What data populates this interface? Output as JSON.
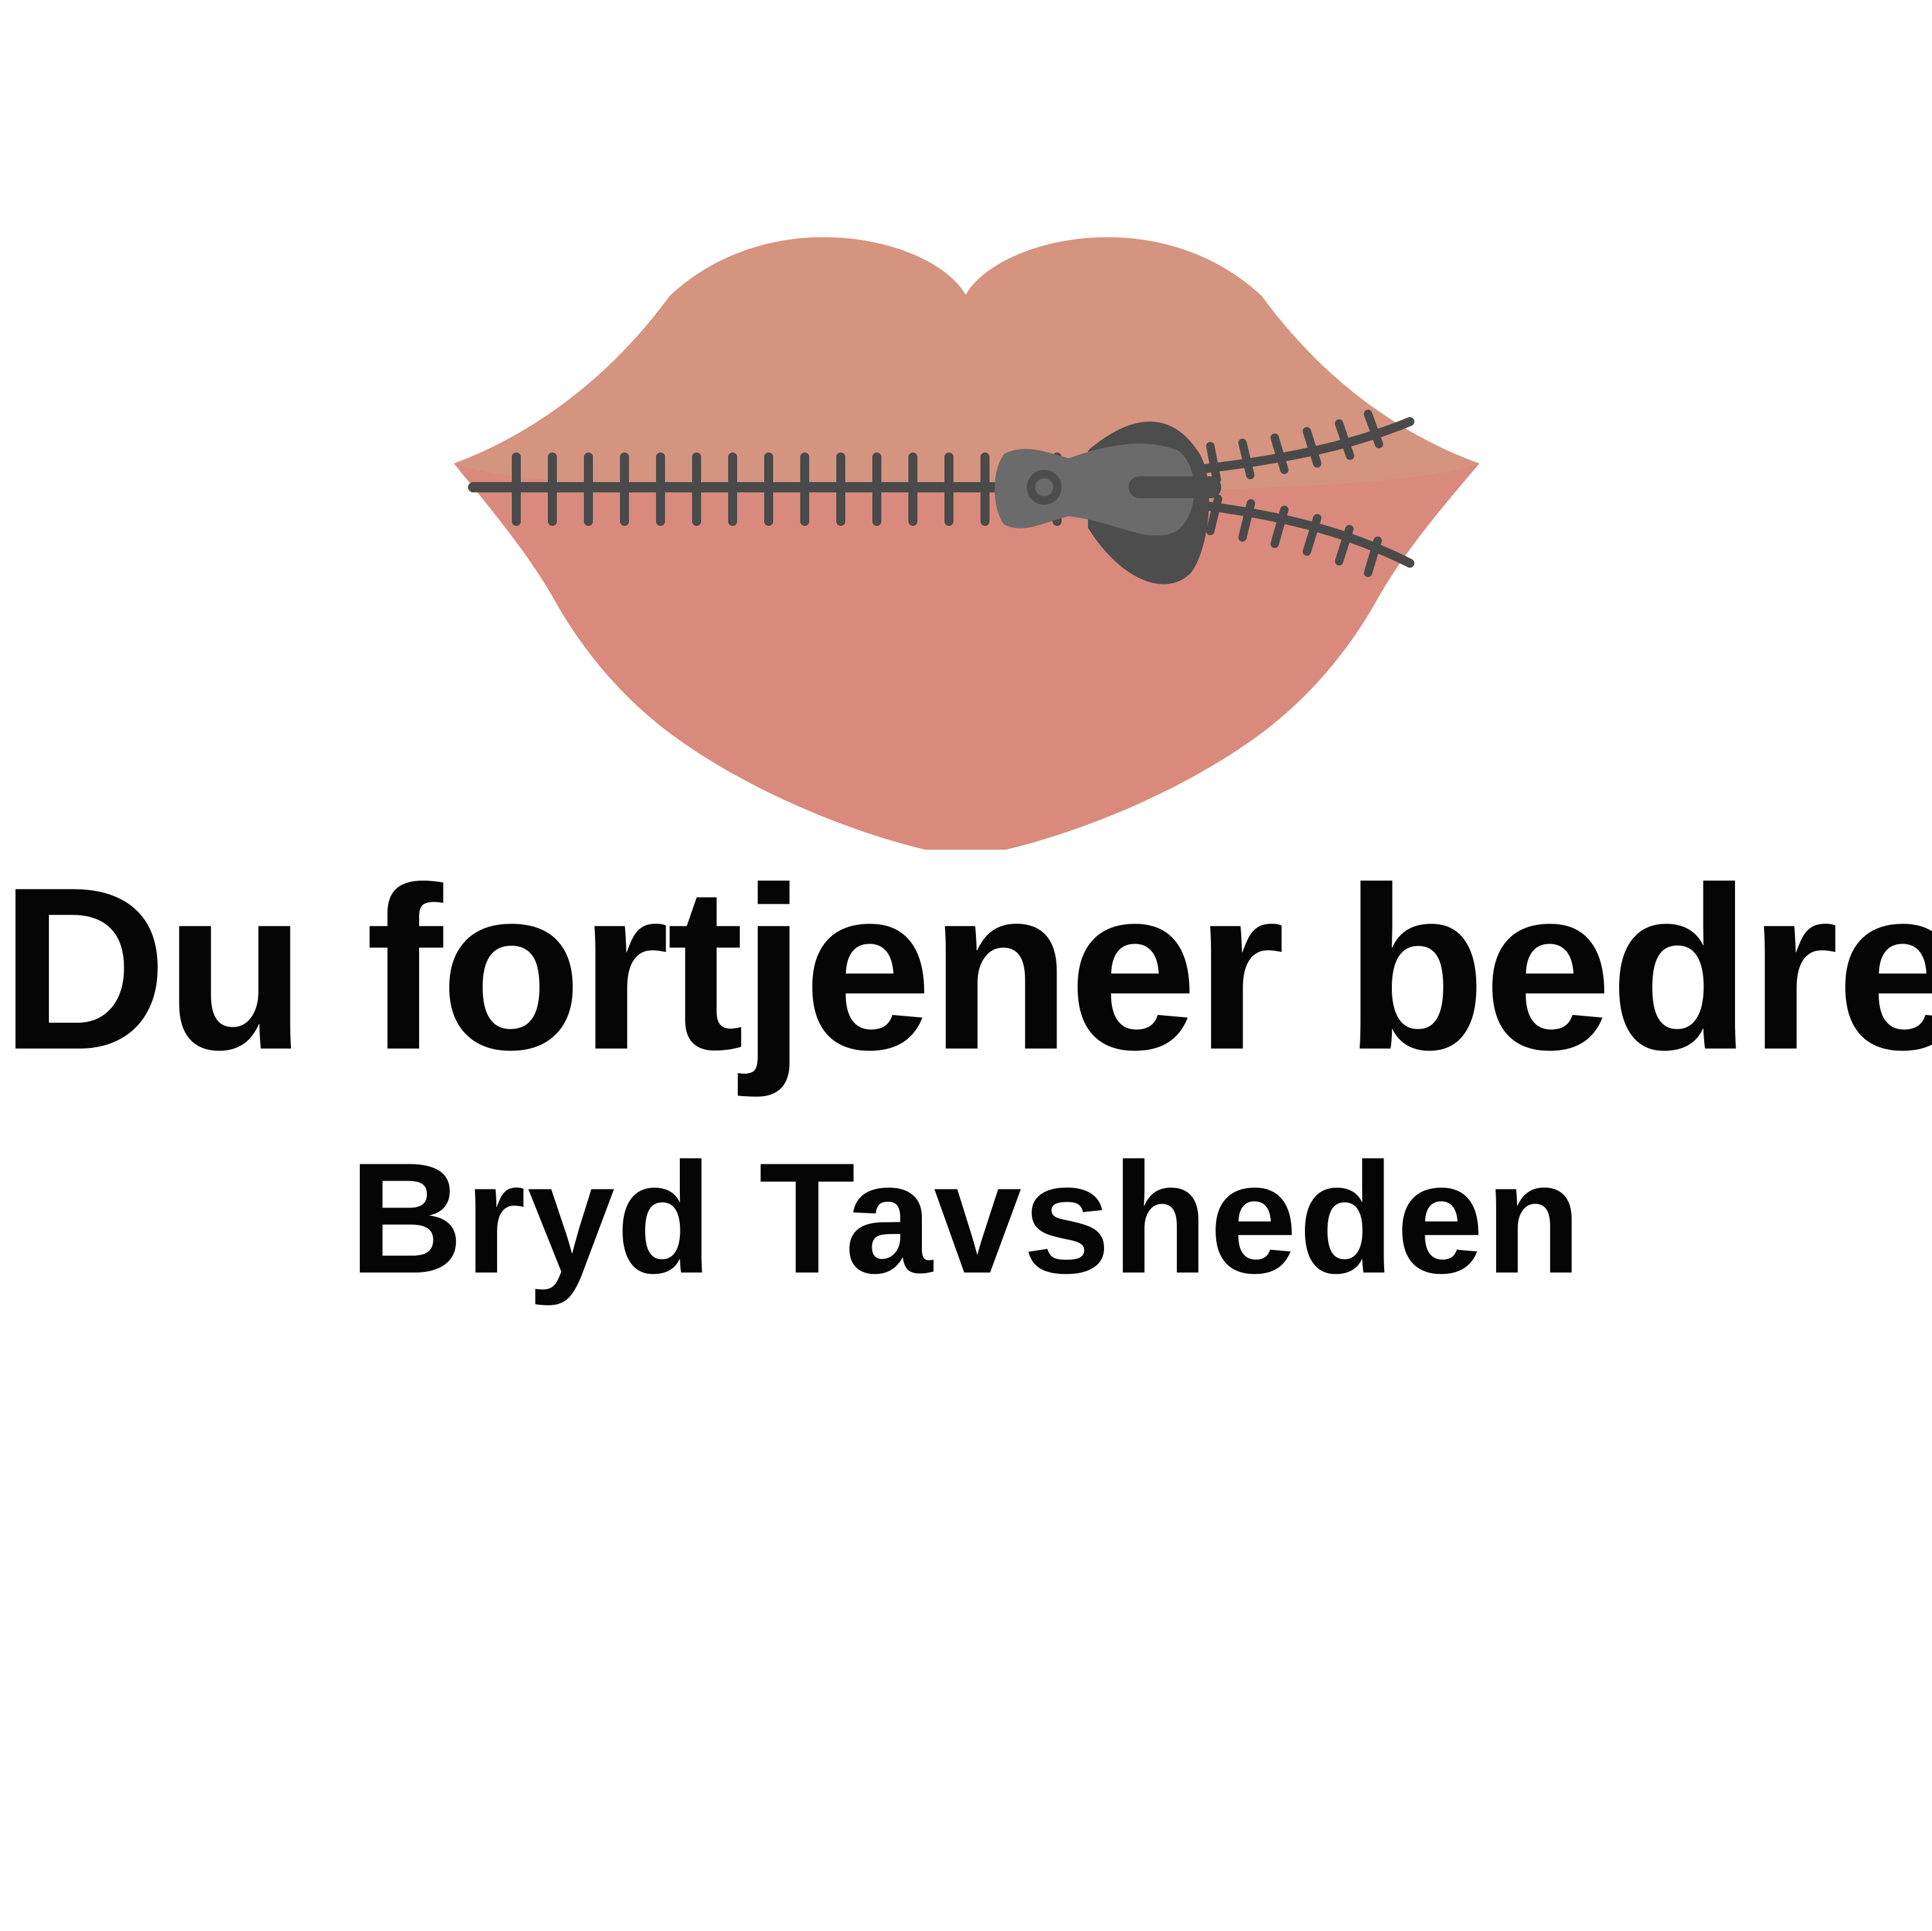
{
  "title": "Du fortjener bedre",
  "subtitle": "Bryd Tavsheden",
  "illustration": {
    "icon": "zipped-lips-icon",
    "colors": {
      "upper_lip": "#d49480",
      "lower_lip": "#d98a7d",
      "zipper_track": "#4a4a4a",
      "zipper_pull": "#6b6b6b",
      "text": "#050505",
      "background": "#ffffff"
    }
  }
}
